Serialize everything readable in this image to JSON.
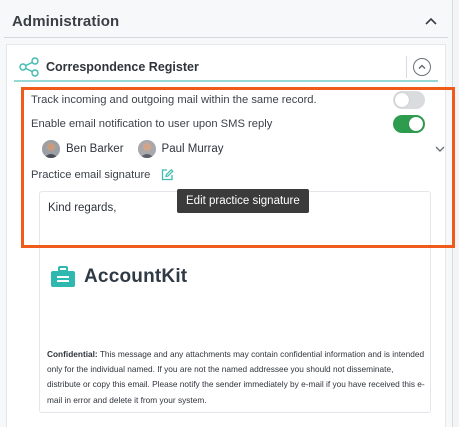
{
  "admin": {
    "title": "Administration"
  },
  "section": {
    "title": "Correspondence Register"
  },
  "settings": {
    "track_label": "Track incoming and outgoing mail within the same record.",
    "track_enabled": false,
    "notify_label": "Enable email notification to user upon SMS reply",
    "notify_enabled": true
  },
  "users": [
    {
      "name": "Ben Barker"
    },
    {
      "name": "Paul Murray"
    }
  ],
  "signature": {
    "label": "Practice email signature",
    "tooltip": "Edit practice signature",
    "greeting": "Kind regards,",
    "logo_text": "AccountKit",
    "disclaimer_title": "Confidential:",
    "disclaimer_body": " This message and any attachments may contain confidential information and is intended only for the individual named. If you are not the named addressee you should not disseminate, distribute or copy this email. Please notify the sender immediately by e-mail if you have received this e-mail in error and delete it from your system."
  },
  "colors": {
    "accent_teal": "#3fbab0",
    "toggle_on": "#2e9c4e",
    "highlight": "#f05a1a"
  }
}
